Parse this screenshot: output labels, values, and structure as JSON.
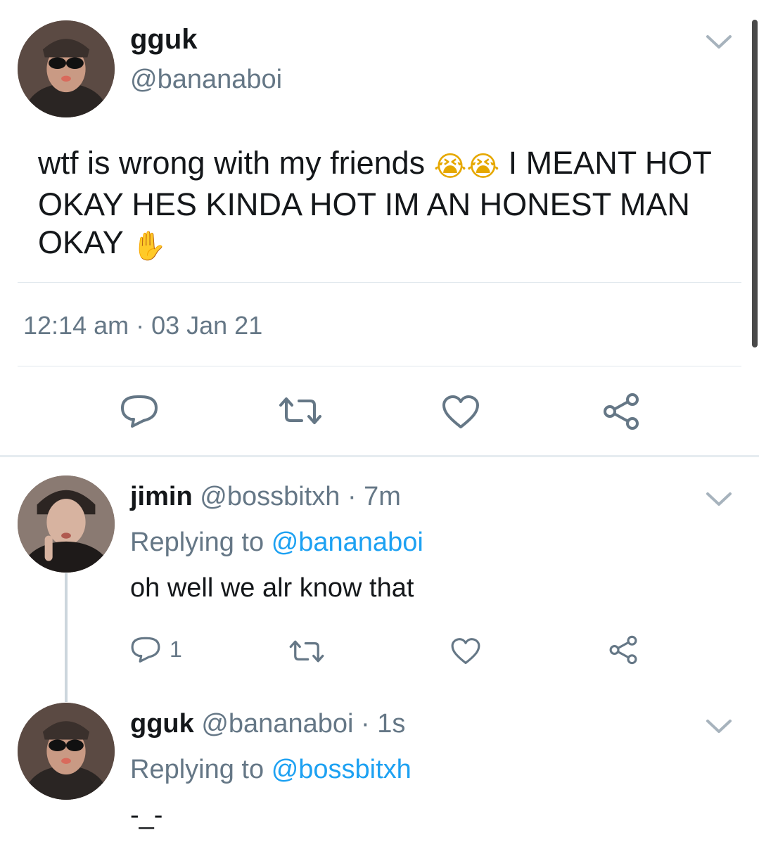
{
  "main_tweet": {
    "author_name": "gguk",
    "author_handle": "@bananaboi",
    "text_part1": "wtf is wrong with my friends",
    "emoji1": "😭😭",
    "text_part2": "I MEANT HOT OKAY HES KINDA HOT IM AN HONEST MAN OKAY",
    "emoji2": "✋",
    "timestamp": "12:14 am · 03 Jan 21"
  },
  "replies": [
    {
      "author_name": "jimin",
      "author_handle": "@bossbitxh",
      "age": "· 7m",
      "replying_prefix": "Replying to",
      "replying_to": "@bananaboi",
      "text": "oh well we alr know that",
      "reply_count": "1"
    },
    {
      "author_name": "gguk",
      "author_handle": "@bananaboi",
      "age": "· 1s",
      "replying_prefix": "Replying to",
      "replying_to": "@bossbitxh",
      "text": "-_-"
    }
  ],
  "icons": {
    "reply": "reply-icon",
    "retweet": "retweet-icon",
    "like": "heart-icon",
    "share": "share-icon",
    "more": "chevron-down-icon"
  },
  "colors": {
    "text": "#14171a",
    "secondary": "#657786",
    "link": "#1da1f2",
    "divider": "#e1e8ed"
  }
}
